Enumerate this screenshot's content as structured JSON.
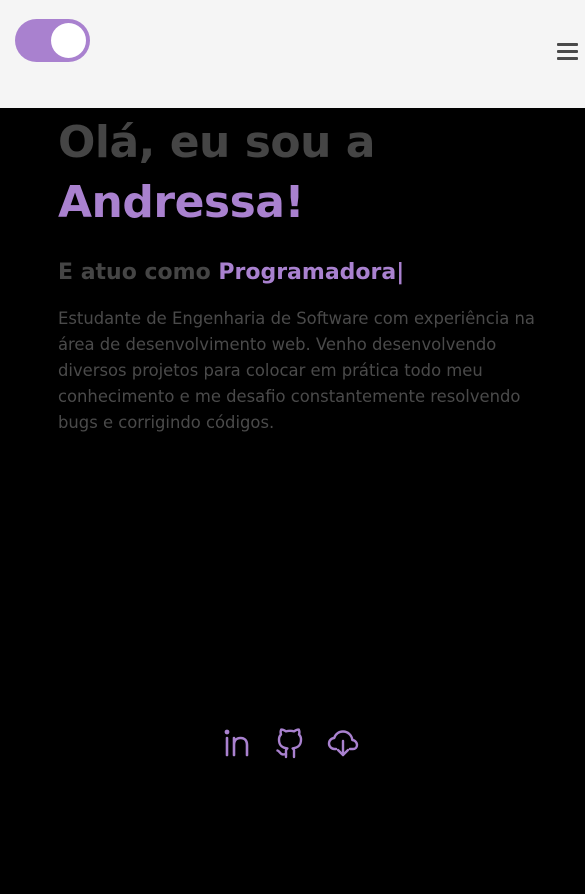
{
  "header": {
    "theme_toggle": "on",
    "menu_icon": "hamburger-icon"
  },
  "hero": {
    "greeting": "Olá, eu sou a",
    "name": "Andressa!",
    "role_prefix": "E atuo como",
    "role": "Programadora|",
    "description": "Estudante de Engenharia de Software com experiência na área de desenvolvimento web. Venho desenvolvendo diversos projetos para colocar em prática todo meu conhecimento e me desafio constantemente resolvendo bugs e corrigindo códigos."
  },
  "socials": [
    {
      "icon": "linkedin-icon"
    },
    {
      "icon": "github-icon"
    },
    {
      "icon": "download-cloud-icon"
    }
  ],
  "colors": {
    "accent": "#a981cf",
    "background": "#000000",
    "header_bg": "#f5f5f5",
    "muted_text": "#454545"
  }
}
